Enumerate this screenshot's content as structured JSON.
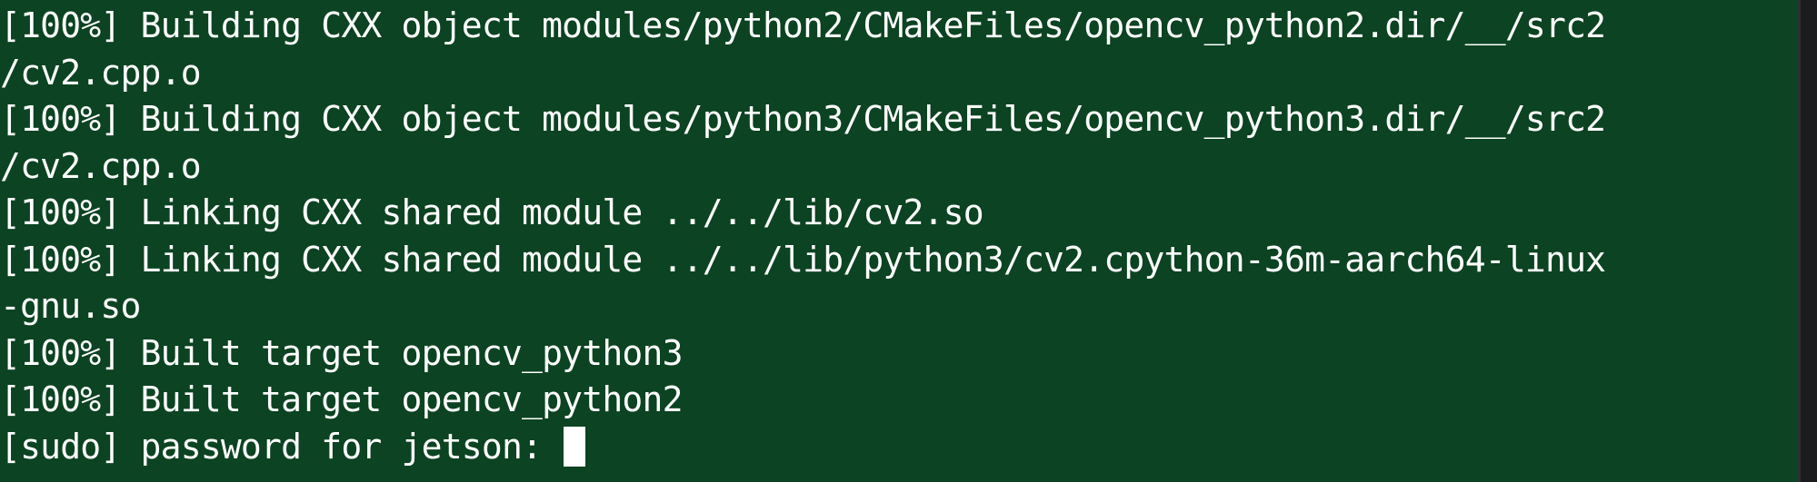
{
  "terminal": {
    "foreground": "#ffffff",
    "background": "#0c4322",
    "scrollbar_track": "#1b1c1d",
    "lines": [
      "[100%] Building CXX object modules/python2/CMakeFiles/opencv_python2.dir/__/src2",
      "/cv2.cpp.o",
      "[100%] Building CXX object modules/python3/CMakeFiles/opencv_python3.dir/__/src2",
      "/cv2.cpp.o",
      "[100%] Linking CXX shared module ../../lib/cv2.so",
      "[100%] Linking CXX shared module ../../lib/python3/cv2.cpython-36m-aarch64-linux",
      "-gnu.so",
      "[100%] Built target opencv_python3",
      "[100%] Built target opencv_python2"
    ],
    "prompt": "[sudo] password for jetson: "
  }
}
